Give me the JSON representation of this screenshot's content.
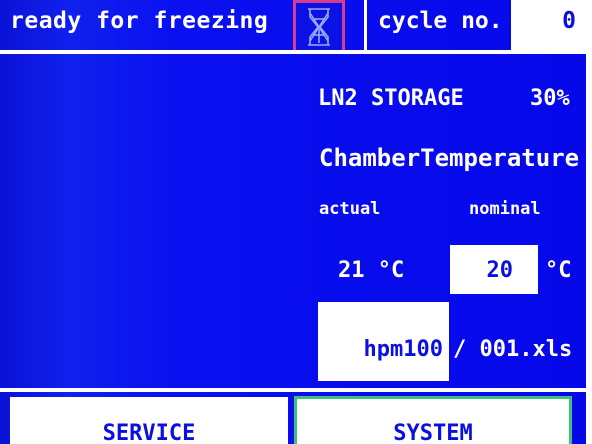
{
  "header": {
    "status_text": "ready for freezing",
    "freeze_icon": "hourglass-freeze-icon",
    "cycle_label": "cycle no.",
    "cycle_value": "0"
  },
  "storage": {
    "label": "LN2 STORAGE",
    "value": "30%"
  },
  "chamber": {
    "title": "ChamberTemperature",
    "actual_label": "actual",
    "nominal_label": "nominal",
    "actual_value": "21 °C",
    "nominal_value": "20",
    "nominal_unit": "°C"
  },
  "file": {
    "name": "hpm100",
    "suffix": "/ 001.xls"
  },
  "buttons": {
    "service_label": "SERVICE",
    "system_label": "SYSTEM"
  },
  "colors": {
    "background": "#0a10f0",
    "accent_text": "#0a10e0",
    "icon_highlight": "#d63c8f",
    "selected_button": "#3fbf7f"
  }
}
